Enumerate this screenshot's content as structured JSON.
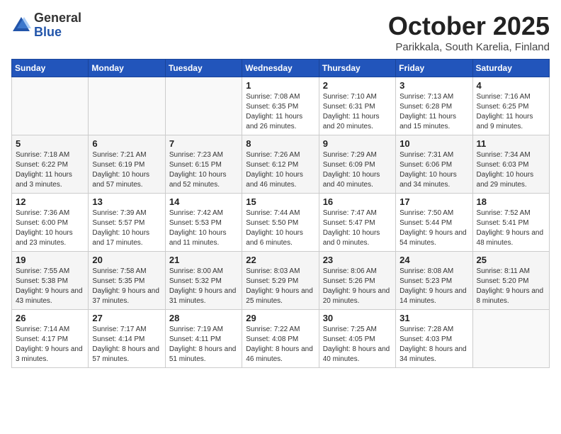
{
  "header": {
    "logo_general": "General",
    "logo_blue": "Blue",
    "month": "October 2025",
    "location": "Parikkala, South Karelia, Finland"
  },
  "weekdays": [
    "Sunday",
    "Monday",
    "Tuesday",
    "Wednesday",
    "Thursday",
    "Friday",
    "Saturday"
  ],
  "weeks": [
    [
      {
        "day": "",
        "info": ""
      },
      {
        "day": "",
        "info": ""
      },
      {
        "day": "",
        "info": ""
      },
      {
        "day": "1",
        "info": "Sunrise: 7:08 AM\nSunset: 6:35 PM\nDaylight: 11 hours and 26 minutes."
      },
      {
        "day": "2",
        "info": "Sunrise: 7:10 AM\nSunset: 6:31 PM\nDaylight: 11 hours and 20 minutes."
      },
      {
        "day": "3",
        "info": "Sunrise: 7:13 AM\nSunset: 6:28 PM\nDaylight: 11 hours and 15 minutes."
      },
      {
        "day": "4",
        "info": "Sunrise: 7:16 AM\nSunset: 6:25 PM\nDaylight: 11 hours and 9 minutes."
      }
    ],
    [
      {
        "day": "5",
        "info": "Sunrise: 7:18 AM\nSunset: 6:22 PM\nDaylight: 11 hours and 3 minutes."
      },
      {
        "day": "6",
        "info": "Sunrise: 7:21 AM\nSunset: 6:19 PM\nDaylight: 10 hours and 57 minutes."
      },
      {
        "day": "7",
        "info": "Sunrise: 7:23 AM\nSunset: 6:15 PM\nDaylight: 10 hours and 52 minutes."
      },
      {
        "day": "8",
        "info": "Sunrise: 7:26 AM\nSunset: 6:12 PM\nDaylight: 10 hours and 46 minutes."
      },
      {
        "day": "9",
        "info": "Sunrise: 7:29 AM\nSunset: 6:09 PM\nDaylight: 10 hours and 40 minutes."
      },
      {
        "day": "10",
        "info": "Sunrise: 7:31 AM\nSunset: 6:06 PM\nDaylight: 10 hours and 34 minutes."
      },
      {
        "day": "11",
        "info": "Sunrise: 7:34 AM\nSunset: 6:03 PM\nDaylight: 10 hours and 29 minutes."
      }
    ],
    [
      {
        "day": "12",
        "info": "Sunrise: 7:36 AM\nSunset: 6:00 PM\nDaylight: 10 hours and 23 minutes."
      },
      {
        "day": "13",
        "info": "Sunrise: 7:39 AM\nSunset: 5:57 PM\nDaylight: 10 hours and 17 minutes."
      },
      {
        "day": "14",
        "info": "Sunrise: 7:42 AM\nSunset: 5:53 PM\nDaylight: 10 hours and 11 minutes."
      },
      {
        "day": "15",
        "info": "Sunrise: 7:44 AM\nSunset: 5:50 PM\nDaylight: 10 hours and 6 minutes."
      },
      {
        "day": "16",
        "info": "Sunrise: 7:47 AM\nSunset: 5:47 PM\nDaylight: 10 hours and 0 minutes."
      },
      {
        "day": "17",
        "info": "Sunrise: 7:50 AM\nSunset: 5:44 PM\nDaylight: 9 hours and 54 minutes."
      },
      {
        "day": "18",
        "info": "Sunrise: 7:52 AM\nSunset: 5:41 PM\nDaylight: 9 hours and 48 minutes."
      }
    ],
    [
      {
        "day": "19",
        "info": "Sunrise: 7:55 AM\nSunset: 5:38 PM\nDaylight: 9 hours and 43 minutes."
      },
      {
        "day": "20",
        "info": "Sunrise: 7:58 AM\nSunset: 5:35 PM\nDaylight: 9 hours and 37 minutes."
      },
      {
        "day": "21",
        "info": "Sunrise: 8:00 AM\nSunset: 5:32 PM\nDaylight: 9 hours and 31 minutes."
      },
      {
        "day": "22",
        "info": "Sunrise: 8:03 AM\nSunset: 5:29 PM\nDaylight: 9 hours and 25 minutes."
      },
      {
        "day": "23",
        "info": "Sunrise: 8:06 AM\nSunset: 5:26 PM\nDaylight: 9 hours and 20 minutes."
      },
      {
        "day": "24",
        "info": "Sunrise: 8:08 AM\nSunset: 5:23 PM\nDaylight: 9 hours and 14 minutes."
      },
      {
        "day": "25",
        "info": "Sunrise: 8:11 AM\nSunset: 5:20 PM\nDaylight: 9 hours and 8 minutes."
      }
    ],
    [
      {
        "day": "26",
        "info": "Sunrise: 7:14 AM\nSunset: 4:17 PM\nDaylight: 9 hours and 3 minutes."
      },
      {
        "day": "27",
        "info": "Sunrise: 7:17 AM\nSunset: 4:14 PM\nDaylight: 8 hours and 57 minutes."
      },
      {
        "day": "28",
        "info": "Sunrise: 7:19 AM\nSunset: 4:11 PM\nDaylight: 8 hours and 51 minutes."
      },
      {
        "day": "29",
        "info": "Sunrise: 7:22 AM\nSunset: 4:08 PM\nDaylight: 8 hours and 46 minutes."
      },
      {
        "day": "30",
        "info": "Sunrise: 7:25 AM\nSunset: 4:05 PM\nDaylight: 8 hours and 40 minutes."
      },
      {
        "day": "31",
        "info": "Sunrise: 7:28 AM\nSunset: 4:03 PM\nDaylight: 8 hours and 34 minutes."
      },
      {
        "day": "",
        "info": ""
      }
    ]
  ]
}
